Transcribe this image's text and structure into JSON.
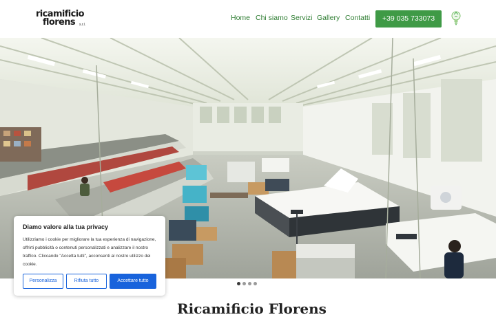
{
  "header": {
    "logo": {
      "line1": "ricamificio",
      "line2": "florens",
      "suffix": "s.r.l."
    },
    "nav": [
      {
        "label": "Home"
      },
      {
        "label": "Chi siamo"
      },
      {
        "label": "Servizi"
      },
      {
        "label": "Gallery"
      },
      {
        "label": "Contatti"
      }
    ],
    "phone_button": "+39 035 733073",
    "bulb_icon": "lightbulb-icon"
  },
  "hero": {
    "image": "embroidery-factory-floor-photo",
    "slider_dots": 4,
    "active_dot": 1
  },
  "main": {
    "title": "Ricamificio Florens"
  },
  "cookie_banner": {
    "title": "Diamo valore alla tua privacy",
    "text": "Utilizziamo i cookie per migliorare la tua esperienza di navigazione, offrirti pubblicità o contenuti personalizzati e analizzare il nostro traffico. Cliccando \"Accetta tutti\", acconsenti al nostro utilizzo dei cookie.",
    "buttons": {
      "customize": "Personalizza",
      "reject": "Rifiuta tutto",
      "accept": "Accettare tutto"
    },
    "accent_color": "#1863dc"
  },
  "colors": {
    "nav_green": "#2e7d32",
    "button_green": "#3f9a46"
  }
}
